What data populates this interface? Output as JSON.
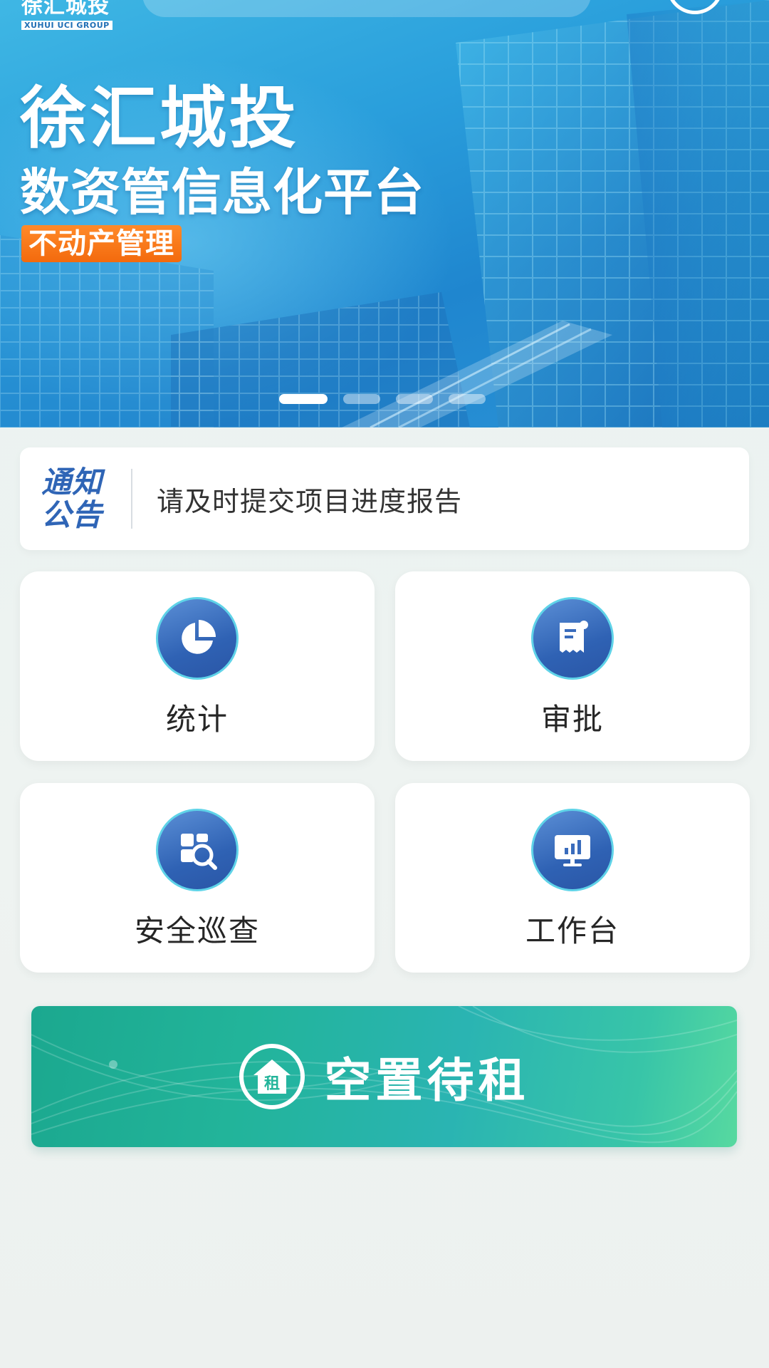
{
  "header": {
    "logo_cn": "徐汇城投",
    "logo_en": "XUHUI UCI GROUP"
  },
  "banner": {
    "title": "徐汇城投",
    "subtitle": "数资管信息化平台",
    "tag": "不动产管理",
    "slide_count": 4,
    "active_slide": 0
  },
  "notice": {
    "badge_line1": "通知",
    "badge_line2": "公告",
    "message": "请及时提交项目进度报告"
  },
  "grid": {
    "items": [
      {
        "label": "统计",
        "icon": "pie-chart-icon"
      },
      {
        "label": "审批",
        "icon": "receipt-icon"
      },
      {
        "label": "安全巡查",
        "icon": "inspection-search-icon"
      },
      {
        "label": "工作台",
        "icon": "monitor-chart-icon"
      }
    ]
  },
  "rent_banner": {
    "label": "空置待租",
    "icon_text": "租",
    "icon": "house-icon"
  },
  "colors": {
    "banner_blue": "#2a9fdc",
    "icon_blue": "#2f62b4",
    "icon_ring": "#5fd3e8",
    "notice_blue": "#2f65b6",
    "tag_orange": "#f36a0d",
    "rent_green": "#22b49a"
  }
}
